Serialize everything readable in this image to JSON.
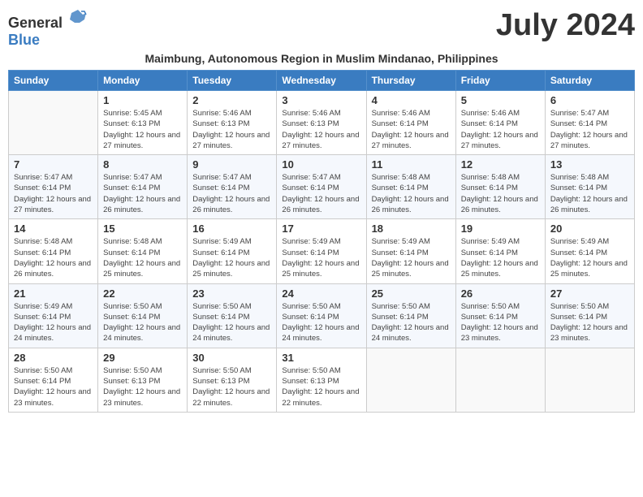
{
  "header": {
    "logo_general": "General",
    "logo_blue": "Blue",
    "month_title": "July 2024",
    "location": "Maimbung, Autonomous Region in Muslim Mindanao, Philippines"
  },
  "calendar": {
    "days_of_week": [
      "Sunday",
      "Monday",
      "Tuesday",
      "Wednesday",
      "Thursday",
      "Friday",
      "Saturday"
    ],
    "weeks": [
      [
        {
          "day": "",
          "sunrise": "",
          "sunset": "",
          "daylight": ""
        },
        {
          "day": "1",
          "sunrise": "Sunrise: 5:45 AM",
          "sunset": "Sunset: 6:13 PM",
          "daylight": "Daylight: 12 hours and 27 minutes."
        },
        {
          "day": "2",
          "sunrise": "Sunrise: 5:46 AM",
          "sunset": "Sunset: 6:13 PM",
          "daylight": "Daylight: 12 hours and 27 minutes."
        },
        {
          "day": "3",
          "sunrise": "Sunrise: 5:46 AM",
          "sunset": "Sunset: 6:13 PM",
          "daylight": "Daylight: 12 hours and 27 minutes."
        },
        {
          "day": "4",
          "sunrise": "Sunrise: 5:46 AM",
          "sunset": "Sunset: 6:14 PM",
          "daylight": "Daylight: 12 hours and 27 minutes."
        },
        {
          "day": "5",
          "sunrise": "Sunrise: 5:46 AM",
          "sunset": "Sunset: 6:14 PM",
          "daylight": "Daylight: 12 hours and 27 minutes."
        },
        {
          "day": "6",
          "sunrise": "Sunrise: 5:47 AM",
          "sunset": "Sunset: 6:14 PM",
          "daylight": "Daylight: 12 hours and 27 minutes."
        }
      ],
      [
        {
          "day": "7",
          "sunrise": "Sunrise: 5:47 AM",
          "sunset": "Sunset: 6:14 PM",
          "daylight": "Daylight: 12 hours and 27 minutes."
        },
        {
          "day": "8",
          "sunrise": "Sunrise: 5:47 AM",
          "sunset": "Sunset: 6:14 PM",
          "daylight": "Daylight: 12 hours and 26 minutes."
        },
        {
          "day": "9",
          "sunrise": "Sunrise: 5:47 AM",
          "sunset": "Sunset: 6:14 PM",
          "daylight": "Daylight: 12 hours and 26 minutes."
        },
        {
          "day": "10",
          "sunrise": "Sunrise: 5:47 AM",
          "sunset": "Sunset: 6:14 PM",
          "daylight": "Daylight: 12 hours and 26 minutes."
        },
        {
          "day": "11",
          "sunrise": "Sunrise: 5:48 AM",
          "sunset": "Sunset: 6:14 PM",
          "daylight": "Daylight: 12 hours and 26 minutes."
        },
        {
          "day": "12",
          "sunrise": "Sunrise: 5:48 AM",
          "sunset": "Sunset: 6:14 PM",
          "daylight": "Daylight: 12 hours and 26 minutes."
        },
        {
          "day": "13",
          "sunrise": "Sunrise: 5:48 AM",
          "sunset": "Sunset: 6:14 PM",
          "daylight": "Daylight: 12 hours and 26 minutes."
        }
      ],
      [
        {
          "day": "14",
          "sunrise": "Sunrise: 5:48 AM",
          "sunset": "Sunset: 6:14 PM",
          "daylight": "Daylight: 12 hours and 26 minutes."
        },
        {
          "day": "15",
          "sunrise": "Sunrise: 5:48 AM",
          "sunset": "Sunset: 6:14 PM",
          "daylight": "Daylight: 12 hours and 25 minutes."
        },
        {
          "day": "16",
          "sunrise": "Sunrise: 5:49 AM",
          "sunset": "Sunset: 6:14 PM",
          "daylight": "Daylight: 12 hours and 25 minutes."
        },
        {
          "day": "17",
          "sunrise": "Sunrise: 5:49 AM",
          "sunset": "Sunset: 6:14 PM",
          "daylight": "Daylight: 12 hours and 25 minutes."
        },
        {
          "day": "18",
          "sunrise": "Sunrise: 5:49 AM",
          "sunset": "Sunset: 6:14 PM",
          "daylight": "Daylight: 12 hours and 25 minutes."
        },
        {
          "day": "19",
          "sunrise": "Sunrise: 5:49 AM",
          "sunset": "Sunset: 6:14 PM",
          "daylight": "Daylight: 12 hours and 25 minutes."
        },
        {
          "day": "20",
          "sunrise": "Sunrise: 5:49 AM",
          "sunset": "Sunset: 6:14 PM",
          "daylight": "Daylight: 12 hours and 25 minutes."
        }
      ],
      [
        {
          "day": "21",
          "sunrise": "Sunrise: 5:49 AM",
          "sunset": "Sunset: 6:14 PM",
          "daylight": "Daylight: 12 hours and 24 minutes."
        },
        {
          "day": "22",
          "sunrise": "Sunrise: 5:50 AM",
          "sunset": "Sunset: 6:14 PM",
          "daylight": "Daylight: 12 hours and 24 minutes."
        },
        {
          "day": "23",
          "sunrise": "Sunrise: 5:50 AM",
          "sunset": "Sunset: 6:14 PM",
          "daylight": "Daylight: 12 hours and 24 minutes."
        },
        {
          "day": "24",
          "sunrise": "Sunrise: 5:50 AM",
          "sunset": "Sunset: 6:14 PM",
          "daylight": "Daylight: 12 hours and 24 minutes."
        },
        {
          "day": "25",
          "sunrise": "Sunrise: 5:50 AM",
          "sunset": "Sunset: 6:14 PM",
          "daylight": "Daylight: 12 hours and 24 minutes."
        },
        {
          "day": "26",
          "sunrise": "Sunrise: 5:50 AM",
          "sunset": "Sunset: 6:14 PM",
          "daylight": "Daylight: 12 hours and 23 minutes."
        },
        {
          "day": "27",
          "sunrise": "Sunrise: 5:50 AM",
          "sunset": "Sunset: 6:14 PM",
          "daylight": "Daylight: 12 hours and 23 minutes."
        }
      ],
      [
        {
          "day": "28",
          "sunrise": "Sunrise: 5:50 AM",
          "sunset": "Sunset: 6:14 PM",
          "daylight": "Daylight: 12 hours and 23 minutes."
        },
        {
          "day": "29",
          "sunrise": "Sunrise: 5:50 AM",
          "sunset": "Sunset: 6:13 PM",
          "daylight": "Daylight: 12 hours and 23 minutes."
        },
        {
          "day": "30",
          "sunrise": "Sunrise: 5:50 AM",
          "sunset": "Sunset: 6:13 PM",
          "daylight": "Daylight: 12 hours and 22 minutes."
        },
        {
          "day": "31",
          "sunrise": "Sunrise: 5:50 AM",
          "sunset": "Sunset: 6:13 PM",
          "daylight": "Daylight: 12 hours and 22 minutes."
        },
        {
          "day": "",
          "sunrise": "",
          "sunset": "",
          "daylight": ""
        },
        {
          "day": "",
          "sunrise": "",
          "sunset": "",
          "daylight": ""
        },
        {
          "day": "",
          "sunrise": "",
          "sunset": "",
          "daylight": ""
        }
      ]
    ]
  }
}
